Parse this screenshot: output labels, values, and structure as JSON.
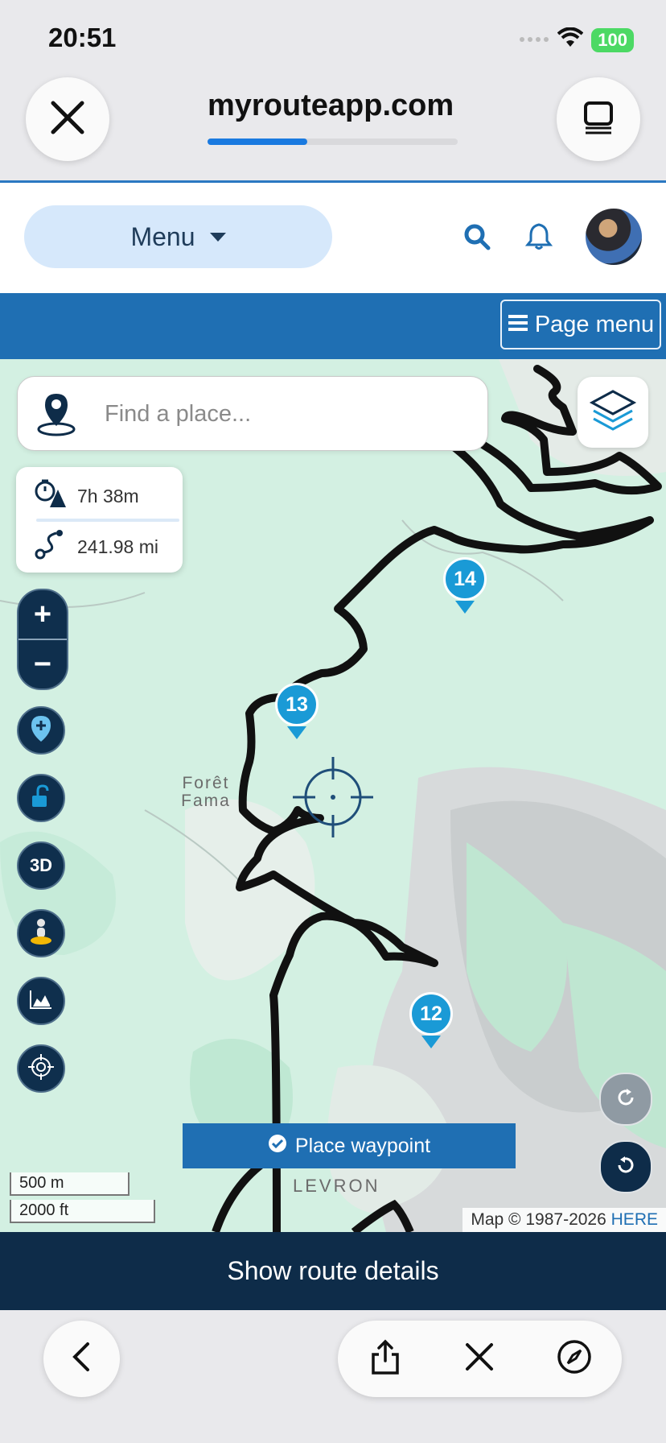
{
  "status_bar": {
    "time": "20:51",
    "battery": "100"
  },
  "browser": {
    "url": "myrouteapp.com",
    "load_progress": 0.4
  },
  "site_header": {
    "menu_label": "Menu"
  },
  "page_bar": {
    "page_menu_label": "Page menu"
  },
  "map": {
    "search_placeholder": "Find a place...",
    "stats": {
      "duration": "7h 38m",
      "distance": "241.98 mi"
    },
    "zoom_in": "+",
    "zoom_out": "−",
    "three_d_label": "3D",
    "markers": [
      "14",
      "13",
      "12"
    ],
    "labels": {
      "foret_line1": "Forêt",
      "foret_line2": "Fama",
      "levron": "LEVRON"
    },
    "place_waypoint_label": "Place waypoint",
    "scale": {
      "metric": "500 m",
      "imperial": "2000 ft"
    },
    "attribution": {
      "text": "Map © 1987-2026",
      "link": "HERE"
    }
  },
  "route_details_label": "Show route details",
  "colors": {
    "primary": "#1f6fb3",
    "dark_navy": "#0e2c49",
    "marker": "#1a9ad6",
    "map_green": "#d3f0e2"
  }
}
